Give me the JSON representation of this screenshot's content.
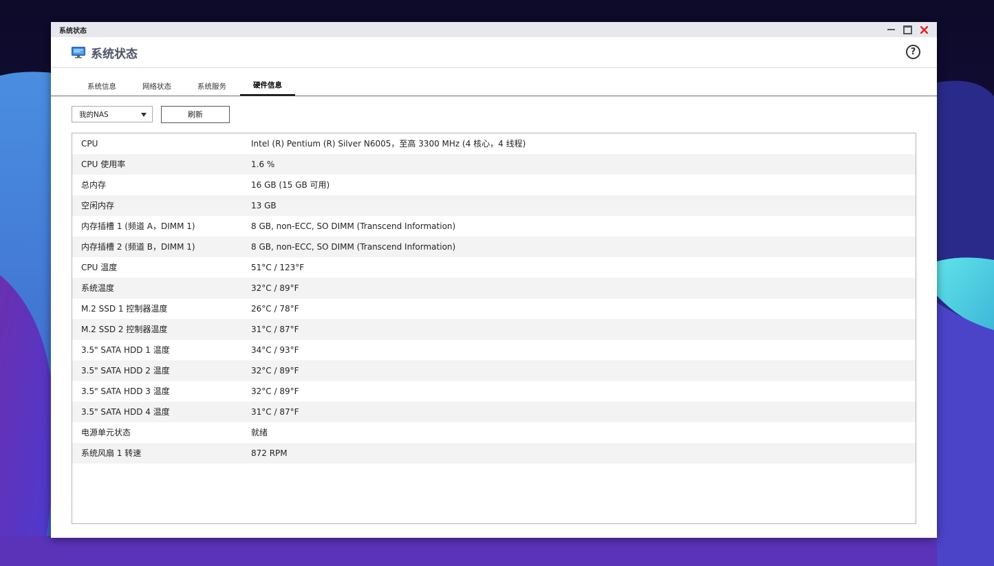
{
  "window": {
    "title": "系统状态"
  },
  "header": {
    "app_title": "系统状态",
    "icon": "monitor-icon",
    "help_icon": "help-icon",
    "help_glyph": "?"
  },
  "tabs": [
    {
      "label": "系统信息",
      "active": false
    },
    {
      "label": "网络状态",
      "active": false
    },
    {
      "label": "系统服务",
      "active": false
    },
    {
      "label": "硬件信息",
      "active": true
    }
  ],
  "toolbar": {
    "device_select_value": "我的NAS",
    "refresh_label": "刷新"
  },
  "hardware_table": [
    {
      "key": "CPU",
      "value": "Intel (R) Pentium (R) Silver N6005，至高 3300 MHz (4 核心，4 线程)"
    },
    {
      "key": "CPU 使用率",
      "value": "1.6 %"
    },
    {
      "key": "总内存",
      "value": "16 GB (15 GB 可用)"
    },
    {
      "key": "空闲内存",
      "value": "13 GB"
    },
    {
      "key": "内存插槽 1 (频道 A，DIMM 1)",
      "value": "8 GB, non-ECC, SO DIMM (Transcend Information)"
    },
    {
      "key": "内存插槽 2 (频道 B，DIMM 1)",
      "value": "8 GB, non-ECC, SO DIMM (Transcend Information)"
    },
    {
      "key": "CPU 温度",
      "value": "51°C / 123°F"
    },
    {
      "key": "系统温度",
      "value": "32°C / 89°F"
    },
    {
      "key": "M.2 SSD 1 控制器温度",
      "value": "26°C / 78°F"
    },
    {
      "key": "M.2 SSD 2 控制器温度",
      "value": "31°C / 87°F"
    },
    {
      "key": "3.5\" SATA HDD 1 温度",
      "value": "34°C / 93°F"
    },
    {
      "key": "3.5\" SATA HDD 2 温度",
      "value": "32°C / 89°F"
    },
    {
      "key": "3.5\" SATA HDD 3 温度",
      "value": "32°C / 89°F"
    },
    {
      "key": "3.5\" SATA HDD 4 温度",
      "value": "31°C / 87°F"
    },
    {
      "key": "电源单元状态",
      "value": "就绪"
    },
    {
      "key": "系统风扇 1 转速",
      "value": "872 RPM"
    }
  ],
  "colors": {
    "close_red": "#e02020",
    "app_icon_blue": "#2f7fd3",
    "title_gray": "#4a5565"
  }
}
